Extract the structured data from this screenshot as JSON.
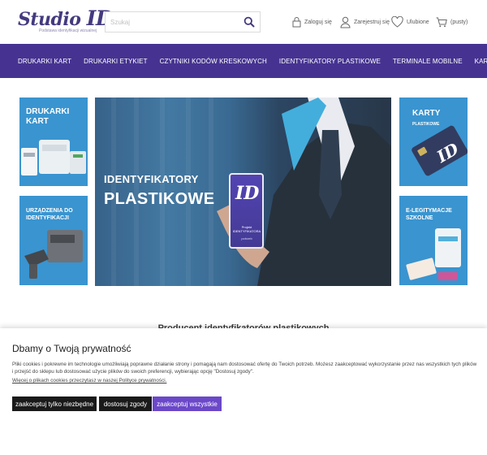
{
  "header": {
    "logo_text": "Studio",
    "logo_id": "ID",
    "logo_tagline": "Podstawa identyfikacji wizualnej",
    "search_placeholder": "Szukaj",
    "login_label": "Zaloguj się",
    "register_label": "Zarejestruj się",
    "favorites_label": "Ulubione",
    "cart_label": "(pusty)"
  },
  "nav": {
    "items": [
      "DRUKARKI KART",
      "DRUKARKI ETYKIET",
      "CZYTNIKI KODÓW KRESKOWYCH",
      "IDENTYFIKATORY PLASTIKOWE",
      "TERMINALE MOBILNE",
      "KARTY"
    ]
  },
  "banners": {
    "card_printers": "DRUKARKI KART",
    "id_devices": "URZĄDZENIA DO IDENTYFIKACJI",
    "hero_line1": "IDENTYFIKATORY",
    "hero_line2": "PLASTIKOWE",
    "hero_badge_id": "ID",
    "hero_badge_text": "Projekt IDENTYFIKATORA",
    "hero_badge_sub": "potrzeb",
    "cards_title": "KARTY",
    "cards_sub": "PLASTIKOWE",
    "elegit_title": "E-LEGITYMACJE SZKOLNE"
  },
  "section_heading": "Producent identyfikatorów plastikowych",
  "cookie": {
    "title": "Dbamy o Twoją prywatność",
    "text": "Pliki cookies i pokrewne im technologie umożliwiają poprawne działanie strony i pomagają nam dostosować ofertę do Twoich potrzeb. Możesz zaakceptować wykorzystanie przez nas wszystkich tych plików i przejść do sklepu lub dostosować użycie plików do swoich preferencji, wybierając opcję \"Dostosuj zgody\".",
    "link": "Więcej o plikach cookies przeczytasz w naszej Polityce prywatności.",
    "btn_necessary": "zaakceptuj tylko niezbędne",
    "btn_customize": "dostosuj zgody",
    "btn_accept_all": "zaakceptuj wszystkie"
  },
  "colors": {
    "nav_bg": "#2d1782",
    "tile_blue": "#1f86c9",
    "btn_dark": "#1a1a1a",
    "btn_accent": "#6b48c8",
    "logo": "#2a1f6e"
  }
}
